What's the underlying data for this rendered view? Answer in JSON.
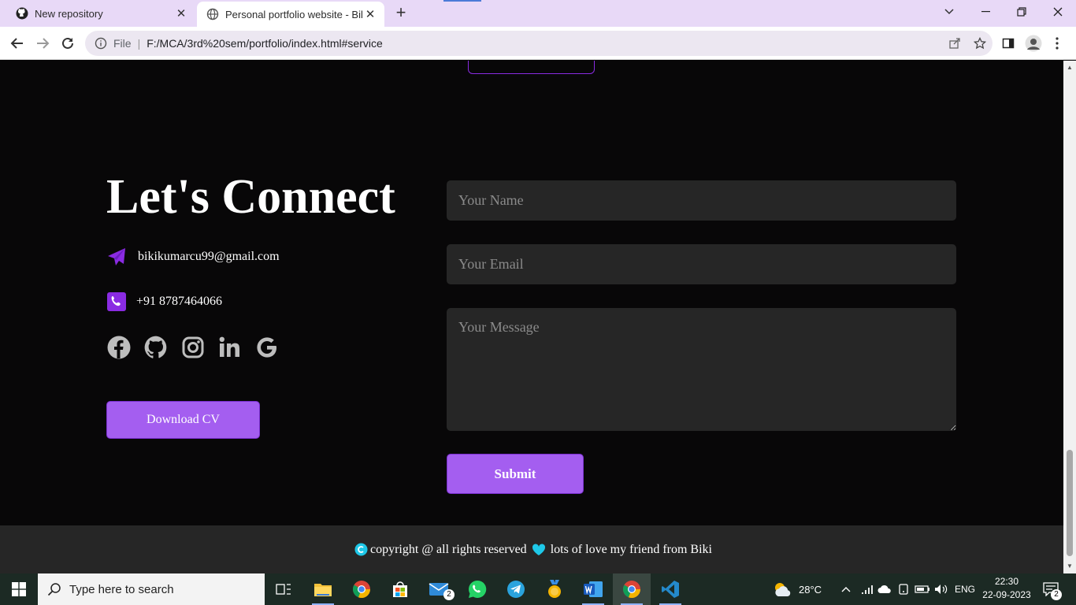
{
  "browser": {
    "tabs": [
      {
        "title": "New repository",
        "icon": "github-icon"
      },
      {
        "title": "Personal portfolio website - Biki",
        "icon": "globe-icon",
        "active": true
      }
    ],
    "address": {
      "scheme_label": "File",
      "url": "F:/MCA/3rd%20sem/portfolio/index.html#service"
    }
  },
  "contact": {
    "title": "Let's Connect",
    "email": "bikikumarcu99@gmail.com",
    "phone": "+91 8787464066",
    "socials": [
      "facebook-icon",
      "github-icon",
      "instagram-icon",
      "linkedin-icon",
      "google-icon"
    ],
    "download_label": "Download CV",
    "accent": "#a45ef0"
  },
  "form": {
    "name_placeholder": "Your Name",
    "email_placeholder": "Your Email",
    "message_placeholder": "Your Message",
    "submit_label": "Submit"
  },
  "footer": {
    "part1": "copyright @ all rights reserved",
    "part2": "lots of love my friend from Biki"
  },
  "taskbar": {
    "search_placeholder": "Type here to search",
    "weather": "28°C",
    "language": "ENG",
    "time": "22:30",
    "date": "22-09-2023",
    "mail_badge": "2",
    "notification_badge": "2"
  }
}
